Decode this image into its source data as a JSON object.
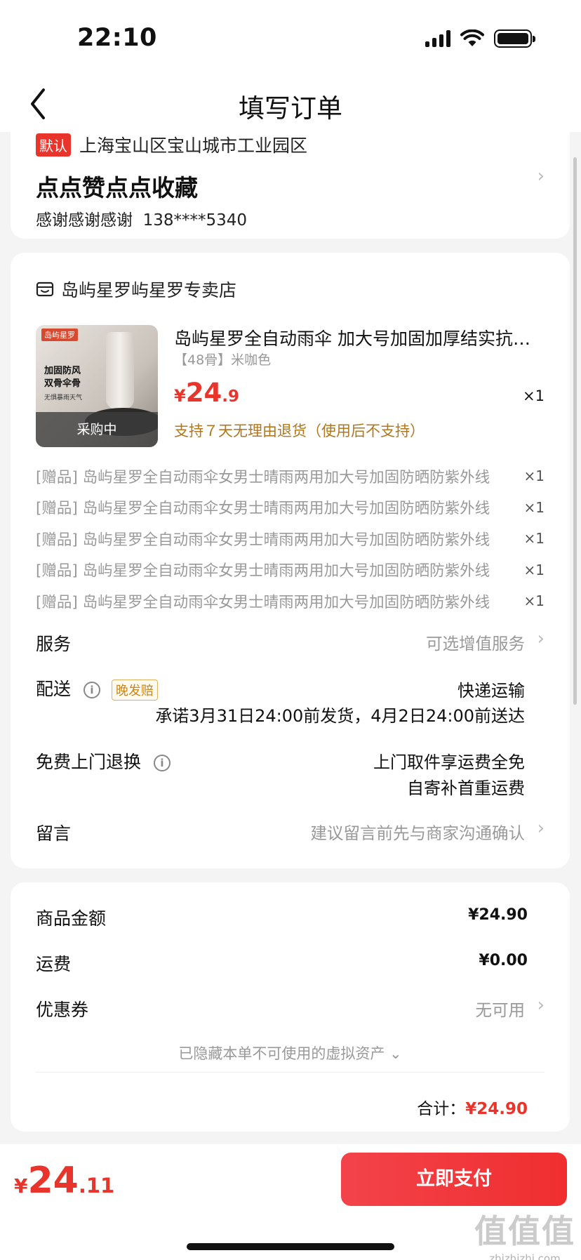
{
  "status": {
    "time": "22:10"
  },
  "nav": {
    "title": "填写订单"
  },
  "address": {
    "tag": "默认",
    "region": "上海宝山区宝山城市工业园区",
    "name": "点点赞点点收藏",
    "contact_name": "感谢感谢感谢",
    "phone": "138****5340"
  },
  "shop": {
    "name": "岛屿星罗屿星罗专卖店"
  },
  "product": {
    "title": "岛屿星罗全自动雨伞 加大号加固加厚结实抗风晴雨两用",
    "spec": "【48骨】米咖色",
    "price_currency": "¥",
    "price_int": "24",
    "price_dec": ".9",
    "qty": "×1",
    "return_policy": "支持７天无理由退货（使用后不支持）",
    "thumb_badge": "采购中",
    "thumb_brand": "岛屿星罗",
    "thumb_line1": "加固防风",
    "thumb_line2": "双骨伞骨",
    "thumb_sub": "无惧暴雨天气"
  },
  "gifts": [
    {
      "name": "[赠品] 岛屿星罗全自动雨伞女男士晴雨两用加大号加固防晒防紫外线",
      "qty": "×1"
    },
    {
      "name": "[赠品] 岛屿星罗全自动雨伞女男士晴雨两用加大号加固防晒防紫外线",
      "qty": "×1"
    },
    {
      "name": "[赠品] 岛屿星罗全自动雨伞女男士晴雨两用加大号加固防晒防紫外线",
      "qty": "×1"
    },
    {
      "name": "[赠品] 岛屿星罗全自动雨伞女男士晴雨两用加大号加固防晒防紫外线",
      "qty": "×1"
    },
    {
      "name": "[赠品] 岛屿星罗全自动雨伞女男士晴雨两用加大号加固防晒防紫外线",
      "qty": "×1"
    }
  ],
  "service": {
    "label": "服务",
    "value": "可选增值服务"
  },
  "delivery": {
    "label": "配送",
    "tag": "晚发赔",
    "method": "快递运输",
    "promise": "承诺3月31日24:00前发货，4月2日24:00前送达"
  },
  "return_pickup": {
    "label": "免费上门退换",
    "line1": "上门取件享运费全免",
    "line2": "自寄补首重运费"
  },
  "message": {
    "label": "留言",
    "placeholder": "建议留言前先与商家沟通确认"
  },
  "summary": {
    "goods_label": "商品金额",
    "goods_value": "¥24.90",
    "shipping_label": "运费",
    "shipping_value": "¥0.00",
    "coupon_label": "优惠券",
    "coupon_value": "无可用",
    "hidden_assets": "已隐藏本单不可使用的虚拟资产",
    "total_label": "合计：",
    "total_value": "¥24.90"
  },
  "bottom": {
    "currency": "¥",
    "price_int": "24",
    "price_dec": ".11",
    "pay_label": "立即支付"
  },
  "watermark": {
    "corner_big": "值值值",
    "corner_small": "zhizhizhi.com"
  },
  "colors": {
    "accent": "#e8342b",
    "pay_button": "#f0393c",
    "promo_text": "#b0771e"
  }
}
